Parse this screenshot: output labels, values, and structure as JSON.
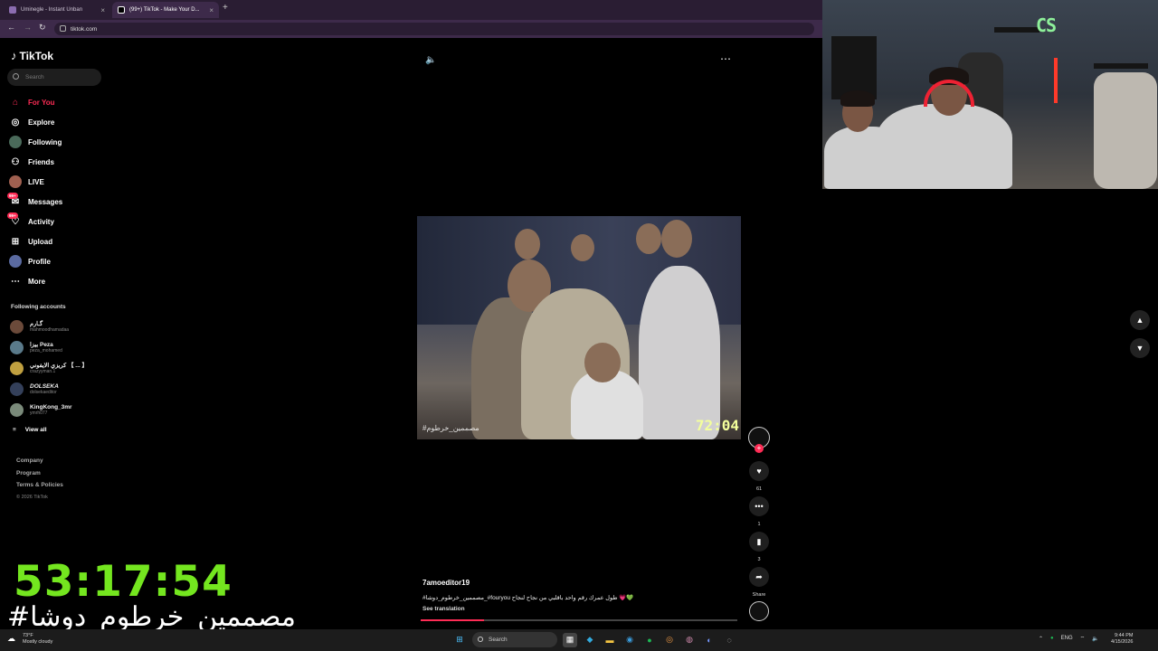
{
  "browser": {
    "tabs": [
      {
        "label": "Uminegle - Instant Unban"
      },
      {
        "label": "(99+) TikTok - Make Your D..."
      }
    ],
    "new_tab": "+",
    "url": "tiktok.com"
  },
  "sidebar": {
    "brand": "TikTok",
    "search_placeholder": "Search",
    "items": [
      {
        "label": "For You",
        "icon": "home-icon"
      },
      {
        "label": "Explore",
        "icon": "compass-icon"
      },
      {
        "label": "Following",
        "icon": "following-icon"
      },
      {
        "label": "Friends",
        "icon": "friends-icon"
      },
      {
        "label": "LIVE",
        "icon": "live-icon"
      },
      {
        "label": "Messages",
        "icon": "messages-icon",
        "badge": "99+"
      },
      {
        "label": "Activity",
        "icon": "activity-icon",
        "badge": "99+"
      },
      {
        "label": "Upload",
        "icon": "upload-icon"
      },
      {
        "label": "Profile",
        "icon": "profile-icon"
      },
      {
        "label": "More",
        "icon": "more-icon"
      }
    ],
    "following_title": "Following accounts",
    "following": [
      {
        "name": "گـارم",
        "handle": "mahmoodhamadaa"
      },
      {
        "name": "بيزا Peza",
        "handle": "peza_mohamed"
      },
      {
        "name": "كريزي الايفوني 【 ... 】",
        "handle": "crazyyman.1"
      },
      {
        "name": "DOLSEKA",
        "handle": "dolsekaeditor"
      },
      {
        "name": "KingKong_3mr",
        "handle": "ymrh077"
      }
    ],
    "view_all": "View all",
    "footer": [
      "Company",
      "Program",
      "Terms & Policies"
    ],
    "copyright": "© 2026 TikTok"
  },
  "player": {
    "video_tag": "#مصممين_خرطوم",
    "timestamp": "72:04",
    "actions": {
      "likes": "61",
      "comments": "1",
      "saves": "3",
      "share": "Share"
    },
    "username": "7amoeditor19",
    "caption": "#مصممين_خرطوم_دوشا_#fouryou طول عمرك رقم واحد باقلبي من نجاح لنجاح 💗💚",
    "see_translation": "See translation",
    "progress": 0.2
  },
  "overlay": {
    "timer": "53:17:54",
    "hashtag": "#مصممين_خرطوم_دوشا"
  },
  "taskbar": {
    "weather_temp": "73°F",
    "weather_desc": "Mostly cloudy",
    "search": "Search",
    "lang": "ENG",
    "time": "9:44 PM",
    "date": "4/15/2026"
  },
  "colors": {
    "accent": "#fe2c55",
    "timer": "#74e61f"
  }
}
